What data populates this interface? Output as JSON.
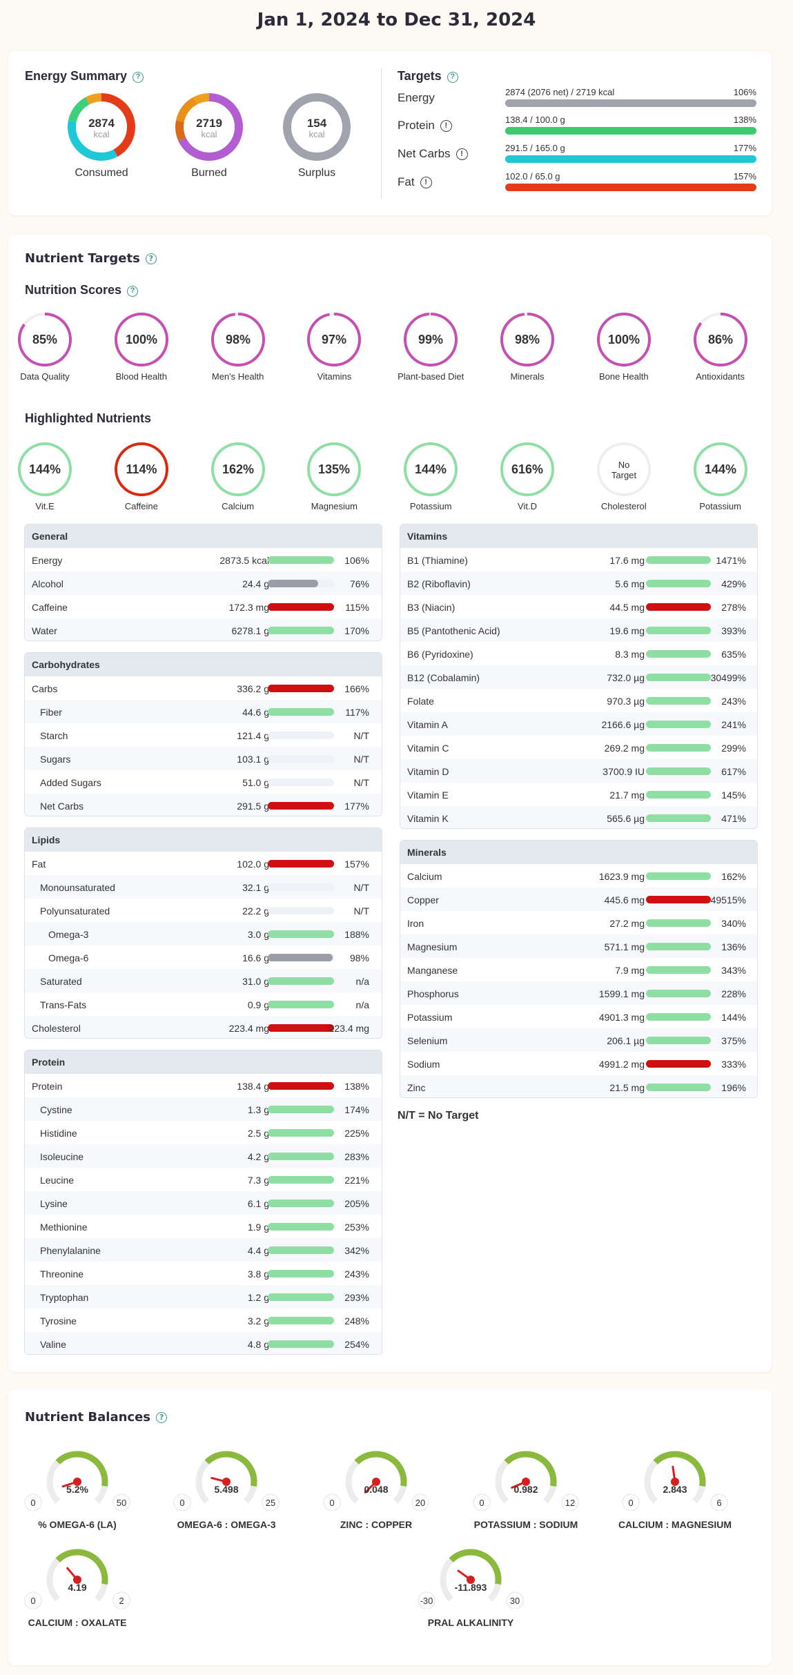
{
  "header": {
    "date_range": "Jan 1, 2024 to Dec 31, 2024"
  },
  "energy_summary": {
    "title": "Energy Summary",
    "donuts": [
      {
        "label": "Consumed",
        "value": "2874",
        "unit": "kcal",
        "segments": [
          {
            "color": "#e33c19",
            "frac": 0.42
          },
          {
            "color": "#1fc8d6",
            "frac": 0.36
          },
          {
            "color": "#3dd07a",
            "frac": 0.14
          },
          {
            "color": "#f0a020",
            "frac": 0.08
          }
        ]
      },
      {
        "label": "Burned",
        "value": "2719",
        "unit": "kcal",
        "segments": [
          {
            "color": "#b35ed0",
            "frac": 0.68
          },
          {
            "color": "#d96b1a",
            "frac": 0.1
          },
          {
            "color": "#e8901a",
            "frac": 0.14
          },
          {
            "color": "#f0a020",
            "frac": 0.08
          }
        ]
      },
      {
        "label": "Surplus",
        "value": "154",
        "unit": "kcal",
        "segments": [
          {
            "color": "#a0a3ae",
            "frac": 1.0
          }
        ]
      }
    ]
  },
  "targets": {
    "title": "Targets",
    "rows": [
      {
        "name": "Energy",
        "value": "2874 (2076 net) / 2719 kcal",
        "pct": "106%",
        "color": "#a0a3ae",
        "fill": 1.0,
        "info": false
      },
      {
        "name": "Protein",
        "value": "138.4 / 100.0 g",
        "pct": "138%",
        "color": "#3dc96e",
        "fill": 1.0,
        "info": true
      },
      {
        "name": "Net Carbs",
        "value": "291.5 / 165.0 g",
        "pct": "177%",
        "color": "#1fc8d6",
        "fill": 1.0,
        "info": true
      },
      {
        "name": "Fat",
        "value": "102.0 / 65.0 g",
        "pct": "157%",
        "color": "#e33c19",
        "fill": 1.0,
        "info": true
      }
    ]
  },
  "nutrient_targets": {
    "title": "Nutrient Targets"
  },
  "nutrition_scores": {
    "title": "Nutrition Scores",
    "items": [
      {
        "label": "Data Quality",
        "value": "85%",
        "frac": 0.85
      },
      {
        "label": "Blood Health",
        "value": "100%",
        "frac": 1.0
      },
      {
        "label": "Men's Health",
        "value": "98%",
        "frac": 0.98
      },
      {
        "label": "Vitamins",
        "value": "97%",
        "frac": 0.97
      },
      {
        "label": "Plant-based Diet",
        "value": "99%",
        "frac": 0.99
      },
      {
        "label": "Minerals",
        "value": "98%",
        "frac": 0.98
      },
      {
        "label": "Bone Health",
        "value": "100%",
        "frac": 1.0
      },
      {
        "label": "Antioxidants",
        "value": "86%",
        "frac": 0.86
      }
    ]
  },
  "highlighted": {
    "title": "Highlighted Nutrients",
    "items": [
      {
        "label": "Vit.E",
        "value": "144%",
        "color": "#8fdfa5"
      },
      {
        "label": "Caffeine",
        "value": "114%",
        "color": "#d92a10"
      },
      {
        "label": "Calcium",
        "value": "162%",
        "color": "#8fdfa5"
      },
      {
        "label": "Magnesium",
        "value": "135%",
        "color": "#8fdfa5"
      },
      {
        "label": "Potassium",
        "value": "144%",
        "color": "#8fdfa5"
      },
      {
        "label": "Vit.D",
        "value": "616%",
        "color": "#8fdfa5"
      },
      {
        "label": "Cholesterol",
        "value": "No Target",
        "color": "#eeeeee"
      },
      {
        "label": "Potassium",
        "value": "144%",
        "color": "#8fdfa5"
      }
    ]
  },
  "tables_left": [
    {
      "title": "General",
      "rows": [
        {
          "name": "Energy",
          "val": "2873.5 kcal",
          "pct": "106%",
          "fill": 1.0,
          "color": "#8fdfa5",
          "indent": 0
        },
        {
          "name": "Alcohol",
          "val": "24.4 g",
          "pct": "76%",
          "fill": 0.76,
          "color": "#9b9ea8",
          "indent": 0
        },
        {
          "name": "Caffeine",
          "val": "172.3 mg",
          "pct": "115%",
          "fill": 1.0,
          "color": "#d01010",
          "indent": 0
        },
        {
          "name": "Water",
          "val": "6278.1 g",
          "pct": "170%",
          "fill": 1.0,
          "color": "#8fdfa5",
          "indent": 0
        }
      ]
    },
    {
      "title": "Carbohydrates",
      "rows": [
        {
          "name": "Carbs",
          "val": "336.2 g",
          "pct": "166%",
          "fill": 1.0,
          "color": "#d01010",
          "indent": 0
        },
        {
          "name": "Fiber",
          "val": "44.6 g",
          "pct": "117%",
          "fill": 1.0,
          "color": "#8fdfa5",
          "indent": 1
        },
        {
          "name": "Starch",
          "val": "121.4 g",
          "pct": "N/T",
          "fill": 0,
          "color": "#8fdfa5",
          "indent": 1
        },
        {
          "name": "Sugars",
          "val": "103.1 g",
          "pct": "N/T",
          "fill": 0,
          "color": "#8fdfa5",
          "indent": 1
        },
        {
          "name": "Added Sugars",
          "val": "51.0 g",
          "pct": "N/T",
          "fill": 0,
          "color": "#8fdfa5",
          "indent": 1
        },
        {
          "name": "Net Carbs",
          "val": "291.5 g",
          "pct": "177%",
          "fill": 1.0,
          "color": "#d01010",
          "indent": 1
        }
      ]
    },
    {
      "title": "Lipids",
      "rows": [
        {
          "name": "Fat",
          "val": "102.0 g",
          "pct": "157%",
          "fill": 1.0,
          "color": "#d01010",
          "indent": 0
        },
        {
          "name": "Monounsaturated",
          "val": "32.1 g",
          "pct": "N/T",
          "fill": 0,
          "color": "#8fdfa5",
          "indent": 1
        },
        {
          "name": "Polyunsaturated",
          "val": "22.2 g",
          "pct": "N/T",
          "fill": 0,
          "color": "#8fdfa5",
          "indent": 1
        },
        {
          "name": "Omega-3",
          "val": "3.0 g",
          "pct": "188%",
          "fill": 1.0,
          "color": "#8fdfa5",
          "indent": 2
        },
        {
          "name": "Omega-6",
          "val": "16.6 g",
          "pct": "98%",
          "fill": 0.98,
          "color": "#9b9ea8",
          "indent": 2
        },
        {
          "name": "Saturated",
          "val": "31.0 g",
          "pct": "n/a",
          "fill": 1.0,
          "color": "#8fdfa5",
          "indent": 1
        },
        {
          "name": "Trans-Fats",
          "val": "0.9 g",
          "pct": "n/a",
          "fill": 1.0,
          "color": "#8fdfa5",
          "indent": 1
        },
        {
          "name": "Cholesterol",
          "val": "223.4 mg",
          "pct": "223.4 mg",
          "fill": 1.0,
          "color": "#d01010",
          "indent": 0
        }
      ]
    },
    {
      "title": "Protein",
      "rows": [
        {
          "name": "Protein",
          "val": "138.4 g",
          "pct": "138%",
          "fill": 1.0,
          "color": "#d01010",
          "indent": 0
        },
        {
          "name": "Cystine",
          "val": "1.3 g",
          "pct": "174%",
          "fill": 1.0,
          "color": "#8fdfa5",
          "indent": 1
        },
        {
          "name": "Histidine",
          "val": "2.5 g",
          "pct": "225%",
          "fill": 1.0,
          "color": "#8fdfa5",
          "indent": 1
        },
        {
          "name": "Isoleucine",
          "val": "4.2 g",
          "pct": "283%",
          "fill": 1.0,
          "color": "#8fdfa5",
          "indent": 1
        },
        {
          "name": "Leucine",
          "val": "7.3 g",
          "pct": "221%",
          "fill": 1.0,
          "color": "#8fdfa5",
          "indent": 1
        },
        {
          "name": "Lysine",
          "val": "6.1 g",
          "pct": "205%",
          "fill": 1.0,
          "color": "#8fdfa5",
          "indent": 1
        },
        {
          "name": "Methionine",
          "val": "1.9 g",
          "pct": "253%",
          "fill": 1.0,
          "color": "#8fdfa5",
          "indent": 1
        },
        {
          "name": "Phenylalanine",
          "val": "4.4 g",
          "pct": "342%",
          "fill": 1.0,
          "color": "#8fdfa5",
          "indent": 1
        },
        {
          "name": "Threonine",
          "val": "3.8 g",
          "pct": "243%",
          "fill": 1.0,
          "color": "#8fdfa5",
          "indent": 1
        },
        {
          "name": "Tryptophan",
          "val": "1.2 g",
          "pct": "293%",
          "fill": 1.0,
          "color": "#8fdfa5",
          "indent": 1
        },
        {
          "name": "Tyrosine",
          "val": "3.2 g",
          "pct": "248%",
          "fill": 1.0,
          "color": "#8fdfa5",
          "indent": 1
        },
        {
          "name": "Valine",
          "val": "4.8 g",
          "pct": "254%",
          "fill": 1.0,
          "color": "#8fdfa5",
          "indent": 1
        }
      ]
    }
  ],
  "tables_right": [
    {
      "title": "Vitamins",
      "rows": [
        {
          "name": "B1 (Thiamine)",
          "val": "17.6 mg",
          "pct": "1471%",
          "fill": 1.0,
          "color": "#8fdfa5",
          "indent": 0
        },
        {
          "name": "B2 (Riboflavin)",
          "val": "5.6 mg",
          "pct": "429%",
          "fill": 1.0,
          "color": "#8fdfa5",
          "indent": 0
        },
        {
          "name": "B3 (Niacin)",
          "val": "44.5 mg",
          "pct": "278%",
          "fill": 1.0,
          "color": "#d01010",
          "indent": 0
        },
        {
          "name": "B5 (Pantothenic Acid)",
          "val": "19.6 mg",
          "pct": "393%",
          "fill": 1.0,
          "color": "#8fdfa5",
          "indent": 0
        },
        {
          "name": "B6 (Pyridoxine)",
          "val": "8.3 mg",
          "pct": "635%",
          "fill": 1.0,
          "color": "#8fdfa5",
          "indent": 0
        },
        {
          "name": "B12 (Cobalamin)",
          "val": "732.0 µg",
          "pct": "30499%",
          "fill": 1.0,
          "color": "#8fdfa5",
          "indent": 0
        },
        {
          "name": "Folate",
          "val": "970.3 µg",
          "pct": "243%",
          "fill": 1.0,
          "color": "#8fdfa5",
          "indent": 0
        },
        {
          "name": "Vitamin A",
          "val": "2166.6 µg",
          "pct": "241%",
          "fill": 1.0,
          "color": "#8fdfa5",
          "indent": 0
        },
        {
          "name": "Vitamin C",
          "val": "269.2 mg",
          "pct": "299%",
          "fill": 1.0,
          "color": "#8fdfa5",
          "indent": 0
        },
        {
          "name": "Vitamin D",
          "val": "3700.9 IU",
          "pct": "617%",
          "fill": 1.0,
          "color": "#8fdfa5",
          "indent": 0
        },
        {
          "name": "Vitamin E",
          "val": "21.7 mg",
          "pct": "145%",
          "fill": 1.0,
          "color": "#8fdfa5",
          "indent": 0
        },
        {
          "name": "Vitamin K",
          "val": "565.6 µg",
          "pct": "471%",
          "fill": 1.0,
          "color": "#8fdfa5",
          "indent": 0
        }
      ]
    },
    {
      "title": "Minerals",
      "rows": [
        {
          "name": "Calcium",
          "val": "1623.9 mg",
          "pct": "162%",
          "fill": 1.0,
          "color": "#8fdfa5",
          "indent": 0
        },
        {
          "name": "Copper",
          "val": "445.6 mg",
          "pct": "49515%",
          "fill": 1.0,
          "color": "#d01010",
          "indent": 0
        },
        {
          "name": "Iron",
          "val": "27.2 mg",
          "pct": "340%",
          "fill": 1.0,
          "color": "#8fdfa5",
          "indent": 0
        },
        {
          "name": "Magnesium",
          "val": "571.1 mg",
          "pct": "136%",
          "fill": 1.0,
          "color": "#8fdfa5",
          "indent": 0
        },
        {
          "name": "Manganese",
          "val": "7.9 mg",
          "pct": "343%",
          "fill": 1.0,
          "color": "#8fdfa5",
          "indent": 0
        },
        {
          "name": "Phosphorus",
          "val": "1599.1 mg",
          "pct": "228%",
          "fill": 1.0,
          "color": "#8fdfa5",
          "indent": 0
        },
        {
          "name": "Potassium",
          "val": "4901.3 mg",
          "pct": "144%",
          "fill": 1.0,
          "color": "#8fdfa5",
          "indent": 0
        },
        {
          "name": "Selenium",
          "val": "206.1 µg",
          "pct": "375%",
          "fill": 1.0,
          "color": "#8fdfa5",
          "indent": 0
        },
        {
          "name": "Sodium",
          "val": "4991.2 mg",
          "pct": "333%",
          "fill": 1.0,
          "color": "#d01010",
          "indent": 0
        },
        {
          "name": "Zinc",
          "val": "21.5 mg",
          "pct": "196%",
          "fill": 1.0,
          "color": "#8fdfa5",
          "indent": 0
        }
      ]
    }
  ],
  "legend_note": "N/T = No Target",
  "balances": {
    "title": "Nutrient Balances",
    "gauges": [
      {
        "label": "% OMEGA-6 (LA)",
        "value": "5.2%",
        "min": "0",
        "max": "50",
        "needle": 0.1
      },
      {
        "label": "OMEGA-6 : OMEGA-3",
        "value": "5.498",
        "min": "0",
        "max": "25",
        "needle": 0.22
      },
      {
        "label": "ZINC : COPPER",
        "value": "0.048",
        "min": "0",
        "max": "20",
        "needle": 0.0024
      },
      {
        "label": "POTASSIUM : SODIUM",
        "value": "0.982",
        "min": "0",
        "max": "12",
        "needle": 0.082
      },
      {
        "label": "CALCIUM : MAGNESIUM",
        "value": "2.843",
        "min": "0",
        "max": "6",
        "needle": 0.47
      },
      {
        "label": "CALCIUM : OXALATE",
        "value": "4.19",
        "min": "0",
        "max": "2",
        "needle": 0.35
      },
      {
        "label": "PRAL ALKALINITY",
        "value": "-11.893",
        "min": "-30",
        "max": "30",
        "needle": 0.3
      }
    ]
  }
}
